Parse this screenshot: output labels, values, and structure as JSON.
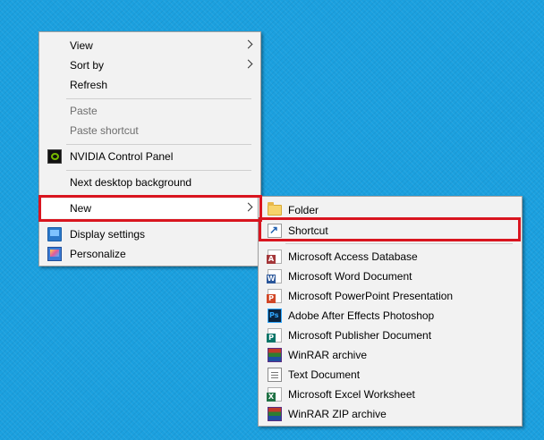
{
  "context_menu": {
    "items": [
      {
        "label": "View",
        "has_submenu": true
      },
      {
        "label": "Sort by",
        "has_submenu": true
      },
      {
        "label": "Refresh"
      },
      {
        "label": "Paste",
        "disabled": true
      },
      {
        "label": "Paste shortcut",
        "disabled": true
      },
      {
        "label": "NVIDIA Control Panel",
        "icon": "nvidia-icon"
      },
      {
        "label": "Next desktop background"
      },
      {
        "label": "New",
        "has_submenu": true,
        "highlighted": true
      },
      {
        "label": "Display settings",
        "icon": "display-settings-icon"
      },
      {
        "label": "Personalize",
        "icon": "personalize-icon"
      }
    ]
  },
  "new_submenu": {
    "items": [
      {
        "label": "Folder",
        "icon": "folder-icon"
      },
      {
        "label": "Shortcut",
        "icon": "shortcut-icon",
        "highlighted": true
      },
      {
        "label": "Microsoft Access Database",
        "icon": "access-icon"
      },
      {
        "label": "Microsoft Word Document",
        "icon": "word-icon"
      },
      {
        "label": "Microsoft PowerPoint Presentation",
        "icon": "powerpoint-icon"
      },
      {
        "label": "Adobe After Effects Photoshop",
        "icon": "photoshop-icon"
      },
      {
        "label": "Microsoft Publisher Document",
        "icon": "publisher-icon"
      },
      {
        "label": "WinRAR archive",
        "icon": "winrar-icon"
      },
      {
        "label": "Text Document",
        "icon": "text-document-icon"
      },
      {
        "label": "Microsoft Excel Worksheet",
        "icon": "excel-icon"
      },
      {
        "label": "WinRAR ZIP archive",
        "icon": "winrar-zip-icon"
      }
    ]
  },
  "colors": {
    "desktop_background": "#1ba0df",
    "menu_background": "#f2f2f2",
    "annotation_red": "#d9151f",
    "access_badge": "#a4373a",
    "word_badge": "#2b579a",
    "powerpoint_badge": "#d24726",
    "publisher_badge": "#077568",
    "excel_badge": "#217346"
  },
  "badges": {
    "access": "A",
    "word": "W",
    "powerpoint": "P",
    "publisher": "P",
    "excel": "X"
  }
}
